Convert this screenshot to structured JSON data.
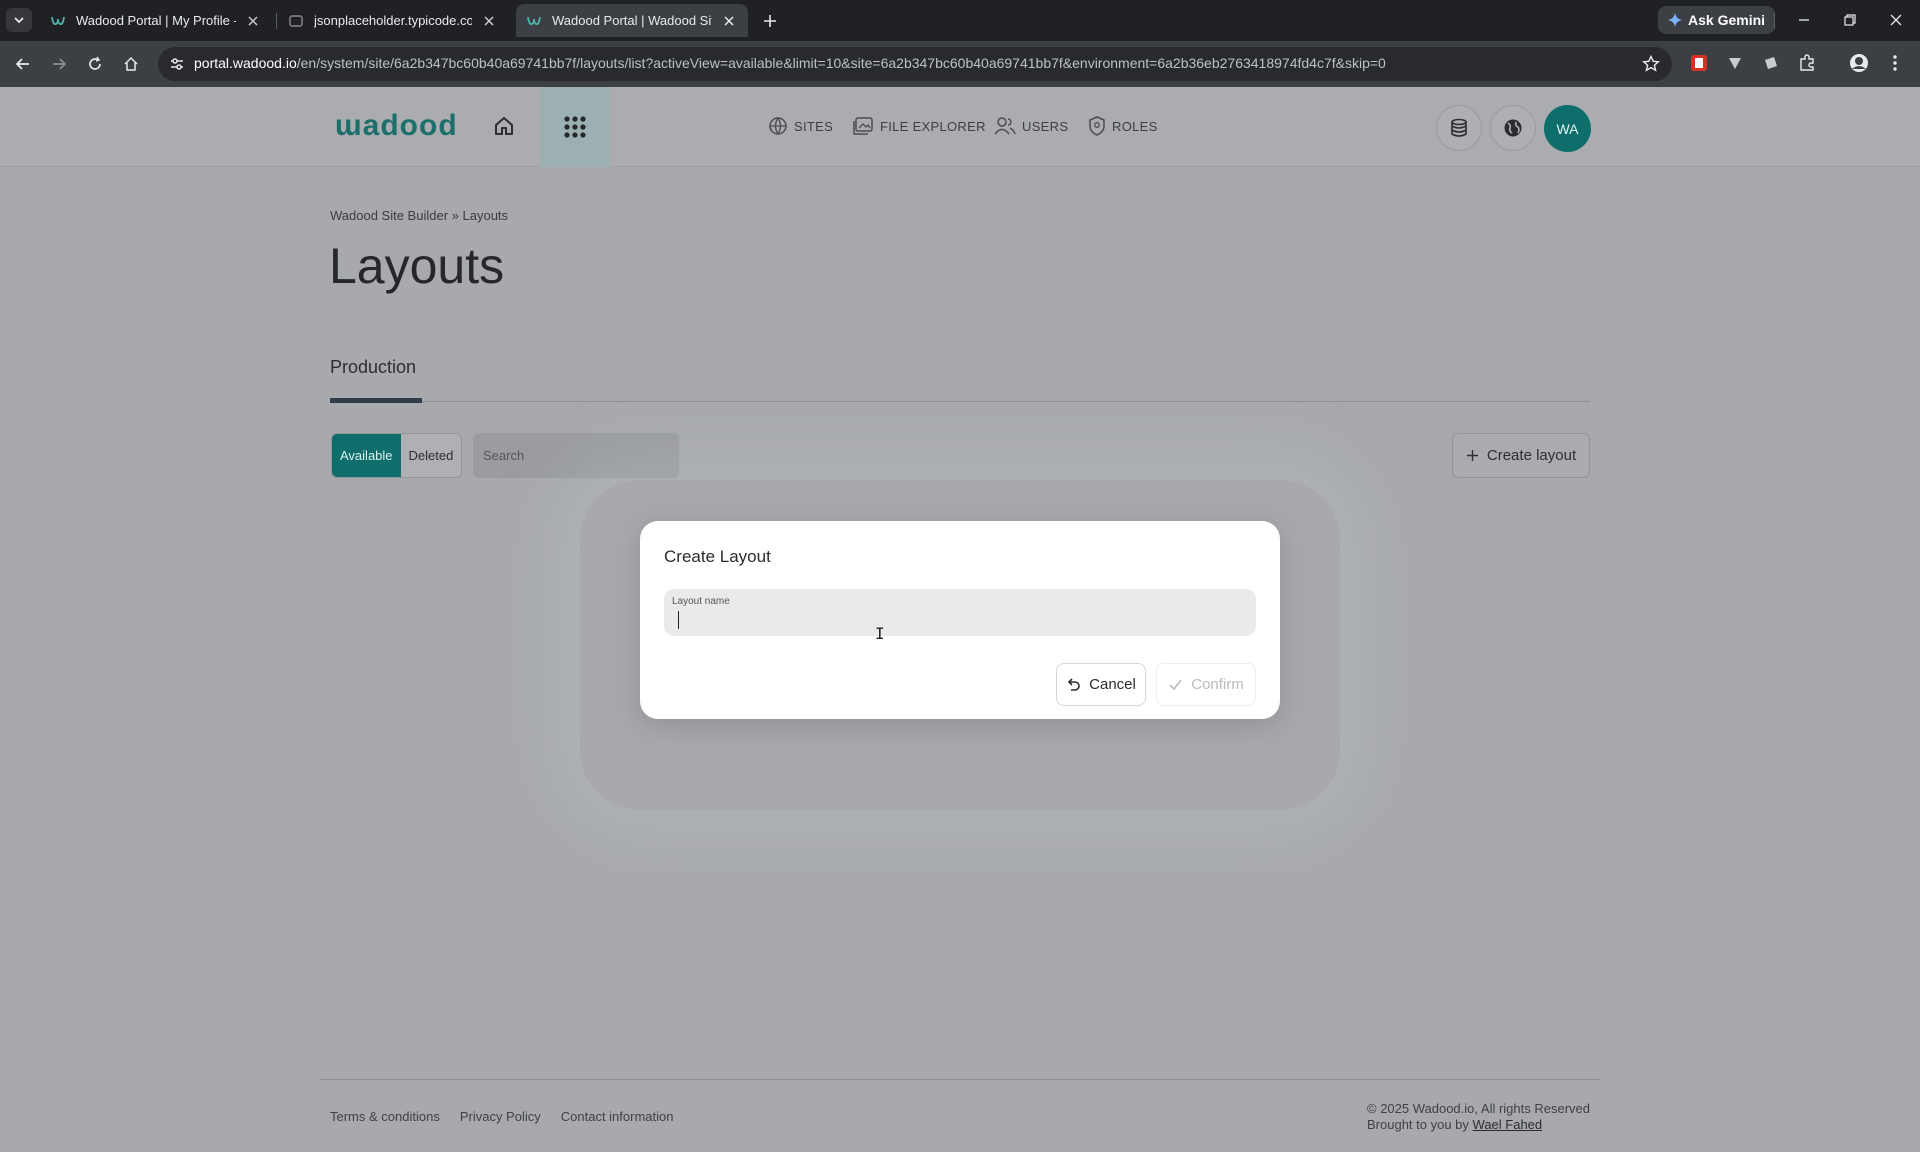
{
  "browser": {
    "tabs": [
      {
        "title": "Wadood Portal | My Profile - Ur",
        "active": false
      },
      {
        "title": "jsonplaceholder.typicode.com/p",
        "active": false
      },
      {
        "title": "Wadood Portal | Wadood Site B",
        "active": true
      }
    ],
    "gemini_label": "Ask Gemini",
    "url_host": "portal.wadood.io",
    "url_path": "/en/system/site/6a2b347bc60b40a69741bb7f/layouts/list?activeView=available&limit=10&site=6a2b347bc60b40a69741bb7f&environment=6a2b36eb2763418974fd4c7f&skip=0"
  },
  "header": {
    "logo": "ɯadood",
    "nav": [
      {
        "label": "SITES",
        "icon": "globe-grid-icon"
      },
      {
        "label": "FILE EXPLORER",
        "icon": "folder-image-icon"
      },
      {
        "label": "USERS",
        "icon": "users-icon"
      },
      {
        "label": "ROLES",
        "icon": "shield-icon"
      }
    ],
    "avatar_initials": "WA"
  },
  "breadcrumb": {
    "root": "Wadood Site Builder",
    "current": "» Layouts"
  },
  "page": {
    "title": "Layouts",
    "environment_tab": "Production",
    "filters": {
      "available": "Available",
      "deleted": "Deleted",
      "active": "Available"
    },
    "search_placeholder": "Search",
    "create_button": "Create layout"
  },
  "modal": {
    "title": "Create Layout",
    "field_label": "Layout name",
    "field_value": "",
    "cancel": "Cancel",
    "confirm": "Confirm"
  },
  "footer": {
    "links": [
      "Terms & conditions",
      "Privacy Policy",
      "Contact information"
    ],
    "copyright": "© 2025 Wadood.io, All rights Reserved",
    "brought_by_prefix": "Brought to you by",
    "author": "Wael Fahed"
  },
  "colors": {
    "brand": "#0d6e6b",
    "overlay_bg": "#a7a9ac",
    "modal_bg": "#ffffff"
  }
}
